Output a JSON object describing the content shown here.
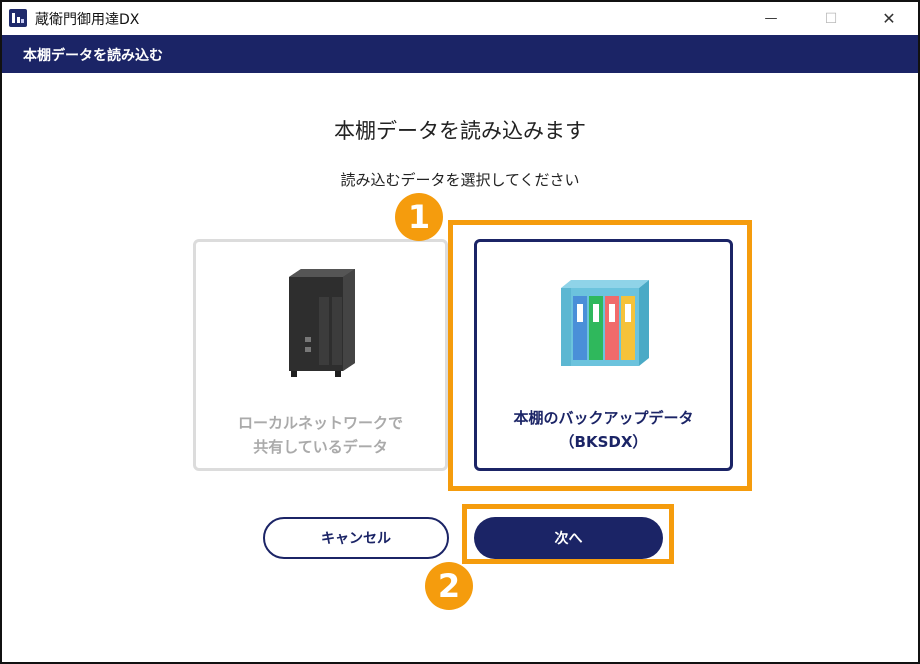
{
  "window": {
    "title": "蔵衛門御用達DX",
    "minimize_glyph": "—",
    "maximize_glyph": "☐",
    "close_glyph": "✕"
  },
  "subheader": {
    "title": "本棚データを読み込む"
  },
  "main": {
    "title": "本棚データを読み込みます",
    "subtitle": "読み込むデータを選択してください"
  },
  "options": [
    {
      "label_line1": "ローカルネットワークで",
      "label_line2": "共有しているデータ",
      "icon": "nas-server-icon",
      "state": "disabled"
    },
    {
      "label_line1": "本棚のバックアップデータ",
      "label_line2": "（BKSDX）",
      "icon": "bookshelf-binders-icon",
      "state": "selected"
    }
  ],
  "buttons": {
    "cancel": "キャンセル",
    "next": "次へ"
  },
  "annotations": {
    "step1": "1",
    "step2": "2"
  },
  "colors": {
    "navy": "#1b2466",
    "accent_orange": "#f59c0d",
    "disabled_gray": "#aaaaaa"
  }
}
